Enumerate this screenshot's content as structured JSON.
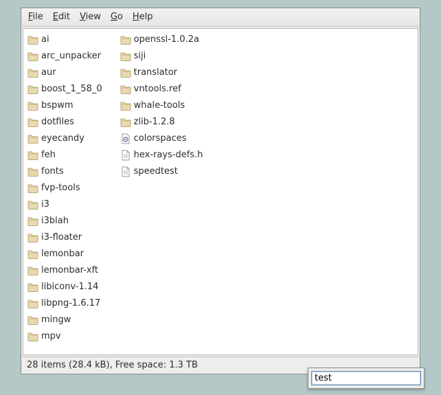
{
  "menu": {
    "file": "File",
    "edit": "Edit",
    "view": "View",
    "go": "Go",
    "help": "Help"
  },
  "items": [
    {
      "name": "ai",
      "type": "folder"
    },
    {
      "name": "arc_unpacker",
      "type": "folder"
    },
    {
      "name": "aur",
      "type": "folder"
    },
    {
      "name": "boost_1_58_0",
      "type": "folder"
    },
    {
      "name": "bspwm",
      "type": "folder"
    },
    {
      "name": "dotfiles",
      "type": "folder"
    },
    {
      "name": "eyecandy",
      "type": "folder"
    },
    {
      "name": "feh",
      "type": "folder"
    },
    {
      "name": "fonts",
      "type": "folder"
    },
    {
      "name": "fvp-tools",
      "type": "folder"
    },
    {
      "name": "i3",
      "type": "folder"
    },
    {
      "name": "i3blah",
      "type": "folder"
    },
    {
      "name": "i3-floater",
      "type": "folder"
    },
    {
      "name": "lemonbar",
      "type": "folder"
    },
    {
      "name": "lemonbar-xft",
      "type": "folder"
    },
    {
      "name": "libiconv-1.14",
      "type": "folder"
    },
    {
      "name": "libpng-1.6.17",
      "type": "folder"
    },
    {
      "name": "mingw",
      "type": "folder"
    },
    {
      "name": "mpv",
      "type": "folder"
    },
    {
      "name": "openssl-1.0.2a",
      "type": "folder"
    },
    {
      "name": "siji",
      "type": "folder"
    },
    {
      "name": "translator",
      "type": "folder"
    },
    {
      "name": "vntools.ref",
      "type": "folder"
    },
    {
      "name": "whale-tools",
      "type": "folder"
    },
    {
      "name": "zlib-1.2.8",
      "type": "folder"
    },
    {
      "name": "colorspaces",
      "type": "config"
    },
    {
      "name": "hex-rays-defs.h",
      "type": "file"
    },
    {
      "name": "speedtest",
      "type": "file"
    }
  ],
  "status": "28 items (28.4 kB), Free space: 1.3 TB",
  "search": {
    "value": "test"
  }
}
